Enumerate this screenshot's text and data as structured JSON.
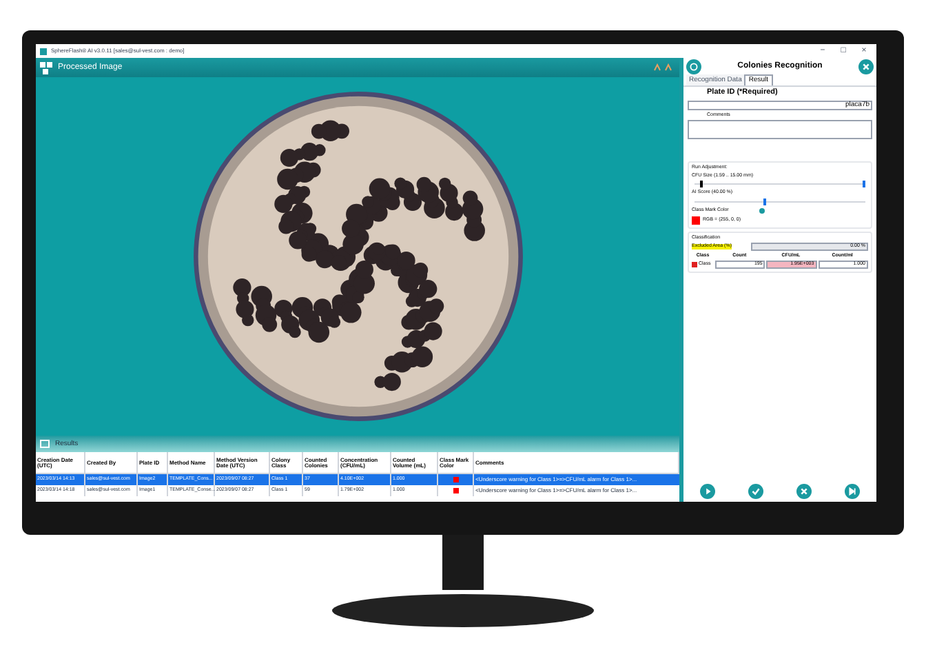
{
  "titlebar": {
    "title": "SphereFlash® AI v3.0.11 [sales@sul-vest.com : demo]",
    "controls": [
      "−",
      "□",
      "×"
    ]
  },
  "image_panel": {
    "title": "Processed Image"
  },
  "results": {
    "title": "Results",
    "columns": [
      "Creation Date (UTC)",
      "Created By",
      "Plate ID",
      "Method Name",
      "Method Version Date (UTC)",
      "Colony Class",
      "Counted Colonies",
      "Concentration (CFU/mL)",
      "Counted Volume (mL)",
      "Class Mark Color",
      "Comments"
    ],
    "rows": [
      {
        "selected": true,
        "cells": [
          "2023/03/14 14:13",
          "sales@sul-vest.com",
          "Image2",
          "TEMPLATE_Cons...",
          "2023/09/07 08:27",
          "Class 1",
          "37",
          "4.10E+002",
          "1.000"
        ],
        "color": "#ff0000",
        "comment": "<Underscore warning for Class 1>=>CFU/mL alarm for Class 1>..."
      },
      {
        "selected": false,
        "cells": [
          "2023/03/14 14:18",
          "sales@sul-vest.com",
          "Image1",
          "TEMPLATE_Conse...",
          "2023/09/07 08:27",
          "Class 1",
          "59",
          "1.79E+002",
          "1.000"
        ],
        "color": "#ff0000",
        "comment": "<Underscore warning for Class 1>=>CFU/mL alarm for Class 1>..."
      }
    ]
  },
  "side_panel": {
    "title": "Colonies Recognition",
    "tabs": [
      {
        "label": "Recognition Data",
        "selected": false
      },
      {
        "label": "Result",
        "selected": true
      }
    ],
    "plate_id": {
      "label": "Plate ID (*Required)",
      "value": "placa7b"
    },
    "comments": {
      "label": "Comments"
    },
    "run_adjustment": {
      "label": "Run Adjustment:",
      "cfu_size": {
        "label": "CFU Size (1.59 .. 15.00 mm)",
        "thumbs": [
          {
            "level": 0.05
          },
          {
            "level": 1
          }
        ]
      },
      "ai_score": {
        "label": "AI Score (40.00 %)",
        "level": 0.4
      },
      "class_mark": {
        "label": "Class Mark Color",
        "color": "#ff0000",
        "value": "RGB = (255, 0, 0)"
      }
    },
    "classification": {
      "label": "Classification",
      "excluded_label": "Excluded Area (%)",
      "excluded_value": "0.00 %",
      "columns": [
        "Class",
        "Count",
        "CFU/mL",
        "Count/ml"
      ],
      "rows": [
        {
          "checked": true,
          "name": "Class",
          "count": "195",
          "cfu": "1.95E+003",
          "volume": "1.000"
        }
      ]
    }
  }
}
